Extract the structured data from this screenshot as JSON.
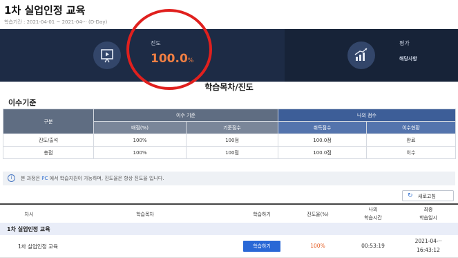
{
  "header": {
    "title": "1차 실업인정 교육",
    "period": "학습기간 : 2021-04-01 ~ 2021-04-·· (D-Day)"
  },
  "banner": {
    "progress_label": "진도",
    "progress_value": "100.0",
    "progress_unit": "%",
    "eval_label": "평가",
    "eval_value": "해당사항"
  },
  "section_title": "학습목차/진도",
  "criteria": {
    "title": "이수기준",
    "headers": {
      "gubun": "구분",
      "criteria_group": "이수 기준",
      "score_group": "나의 점수",
      "ratio": "배점(%)",
      "standard": "기준점수",
      "acquired": "취득점수",
      "status": "이수현황"
    },
    "rows": [
      {
        "name": "진도/출석",
        "ratio": "100%",
        "standard": "100점",
        "acquired": "100.0점",
        "status": "완료"
      },
      {
        "name": "총점",
        "ratio": "100%",
        "standard": "100점",
        "acquired": "100.0점",
        "status": "이수"
      }
    ]
  },
  "notice": {
    "icon": "i",
    "before": "본 과정은",
    "pc": "PC",
    "after": "에서 학습지원이 가능하며, 진도율은 항상 진도율 입니다."
  },
  "refresh_label": "새로고침",
  "list": {
    "headers": {
      "chapter": "차시",
      "toc": "학습목차",
      "study": "학습하기",
      "progress": "진도율(%)",
      "my_time_1": "나의",
      "my_time_2": "학습시간",
      "last_1": "최종",
      "last_2": "학습일시"
    },
    "group": "1차 실업인정 교육",
    "item": {
      "name": "1차 실업인정 교육",
      "button": "학습하기",
      "progress": "100%",
      "time": "00:53:19",
      "date": "2021-04-··",
      "clock": "16:43:12"
    }
  },
  "colors": {
    "banner_bg": "#1d2b45",
    "accent_orange": "#f07f43",
    "annotation_red": "#e0201e",
    "button_blue": "#2968d6"
  }
}
